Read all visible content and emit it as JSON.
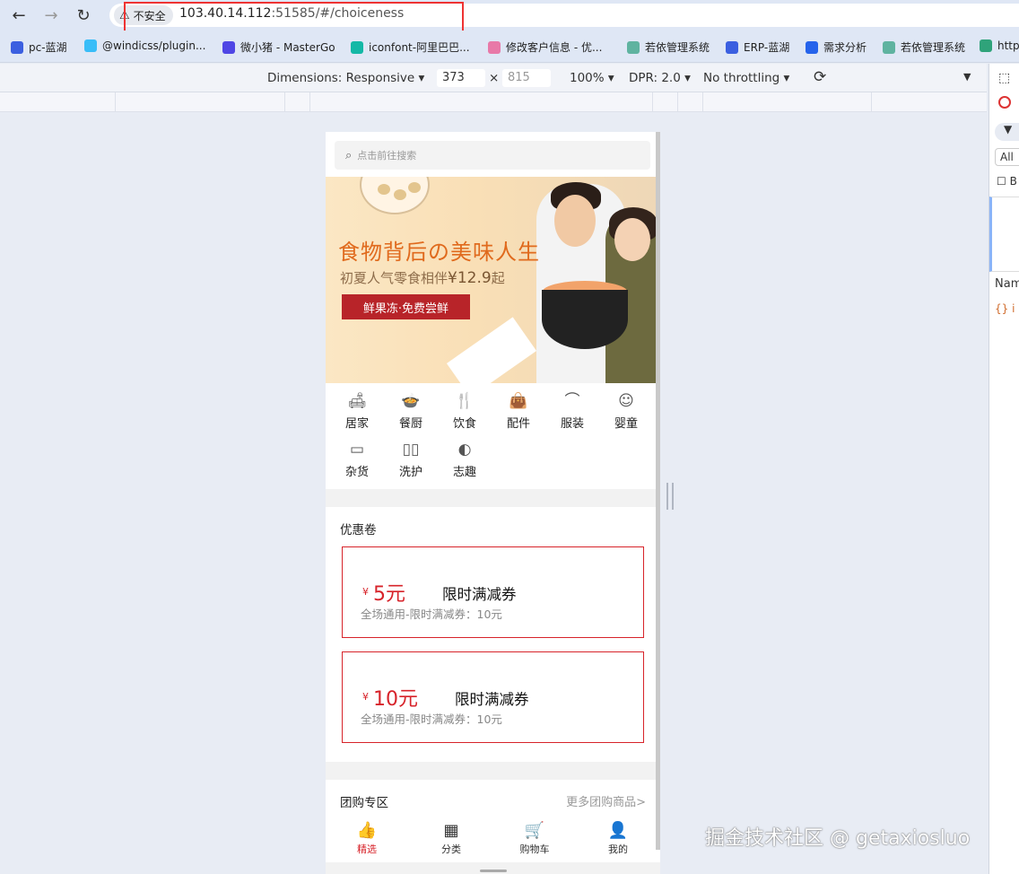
{
  "browser": {
    "security_label": "不安全",
    "url_host": "103.40.14.112",
    "url_rest": ":51585/#/choiceness",
    "bookmarks": [
      "pc-蓝湖",
      "@windicss/plugin...",
      "微小猪 - MasterGo",
      "iconfont-阿里巴巴...",
      "修改客户信息 - 优...",
      "若依管理系统",
      "ERP-蓝湖",
      "需求分析",
      "若依管理系统",
      "http"
    ]
  },
  "devtools": {
    "dimensions_label": "Dimensions: Responsive ▾",
    "width": "373",
    "times": "×",
    "height": "815",
    "zoom": "100% ▾",
    "dpr": "DPR: 2.0 ▾",
    "throttle": "No throttling ▾",
    "panel_all": "All",
    "panel_b": "B",
    "panel_name": "Nam",
    "panel_row": "{} i"
  },
  "app": {
    "search_placeholder": "点击前往搜索",
    "banner": {
      "title": "食物背后の美味人生",
      "subtitle_prefix": "初夏人气零食相伴",
      "subtitle_price": "¥12.9",
      "subtitle_suffix": "起",
      "button": "鲜果冻·免费尝鲜"
    },
    "categories": [
      {
        "label": "居家",
        "icon": "sofa-icon",
        "glyph": "🛋"
      },
      {
        "label": "餐厨",
        "icon": "pot-icon",
        "glyph": "🍲"
      },
      {
        "label": "饮食",
        "icon": "utensils-icon",
        "glyph": "🍴"
      },
      {
        "label": "配件",
        "icon": "bag-icon",
        "glyph": "👜"
      },
      {
        "label": "服装",
        "icon": "hanger-icon",
        "glyph": "⌒"
      },
      {
        "label": "婴童",
        "icon": "baby-icon",
        "glyph": "☺"
      },
      {
        "label": "杂货",
        "icon": "box-icon",
        "glyph": "▭"
      },
      {
        "label": "洗护",
        "icon": "bottles-icon",
        "glyph": "▯▯"
      },
      {
        "label": "志趣",
        "icon": "globe-icon",
        "glyph": "◐"
      }
    ],
    "coupons_title": "优惠卷",
    "coupons": [
      {
        "yen": "¥",
        "amount": "5元",
        "name": "限时满减券",
        "desc": "全场通用-限时满减券：10元"
      },
      {
        "yen": "¥",
        "amount": "10元",
        "name": "限时满减券",
        "desc": "全场通用-限时满减券：10元"
      }
    ],
    "group_title": "团购专区",
    "group_more": "更多团购商品>",
    "tabs": [
      {
        "label": "精选",
        "icon": "thumbs-up-icon",
        "glyph": "👍",
        "active": true
      },
      {
        "label": "分类",
        "icon": "grid-icon",
        "glyph": "▦",
        "active": false
      },
      {
        "label": "购物车",
        "icon": "cart-icon",
        "glyph": "🛒",
        "active": false
      },
      {
        "label": "我的",
        "icon": "user-icon",
        "glyph": "👤",
        "active": false
      }
    ],
    "accent_color": "#d7232a"
  },
  "watermark": "掘金技术社区 @ getaxiosluo"
}
